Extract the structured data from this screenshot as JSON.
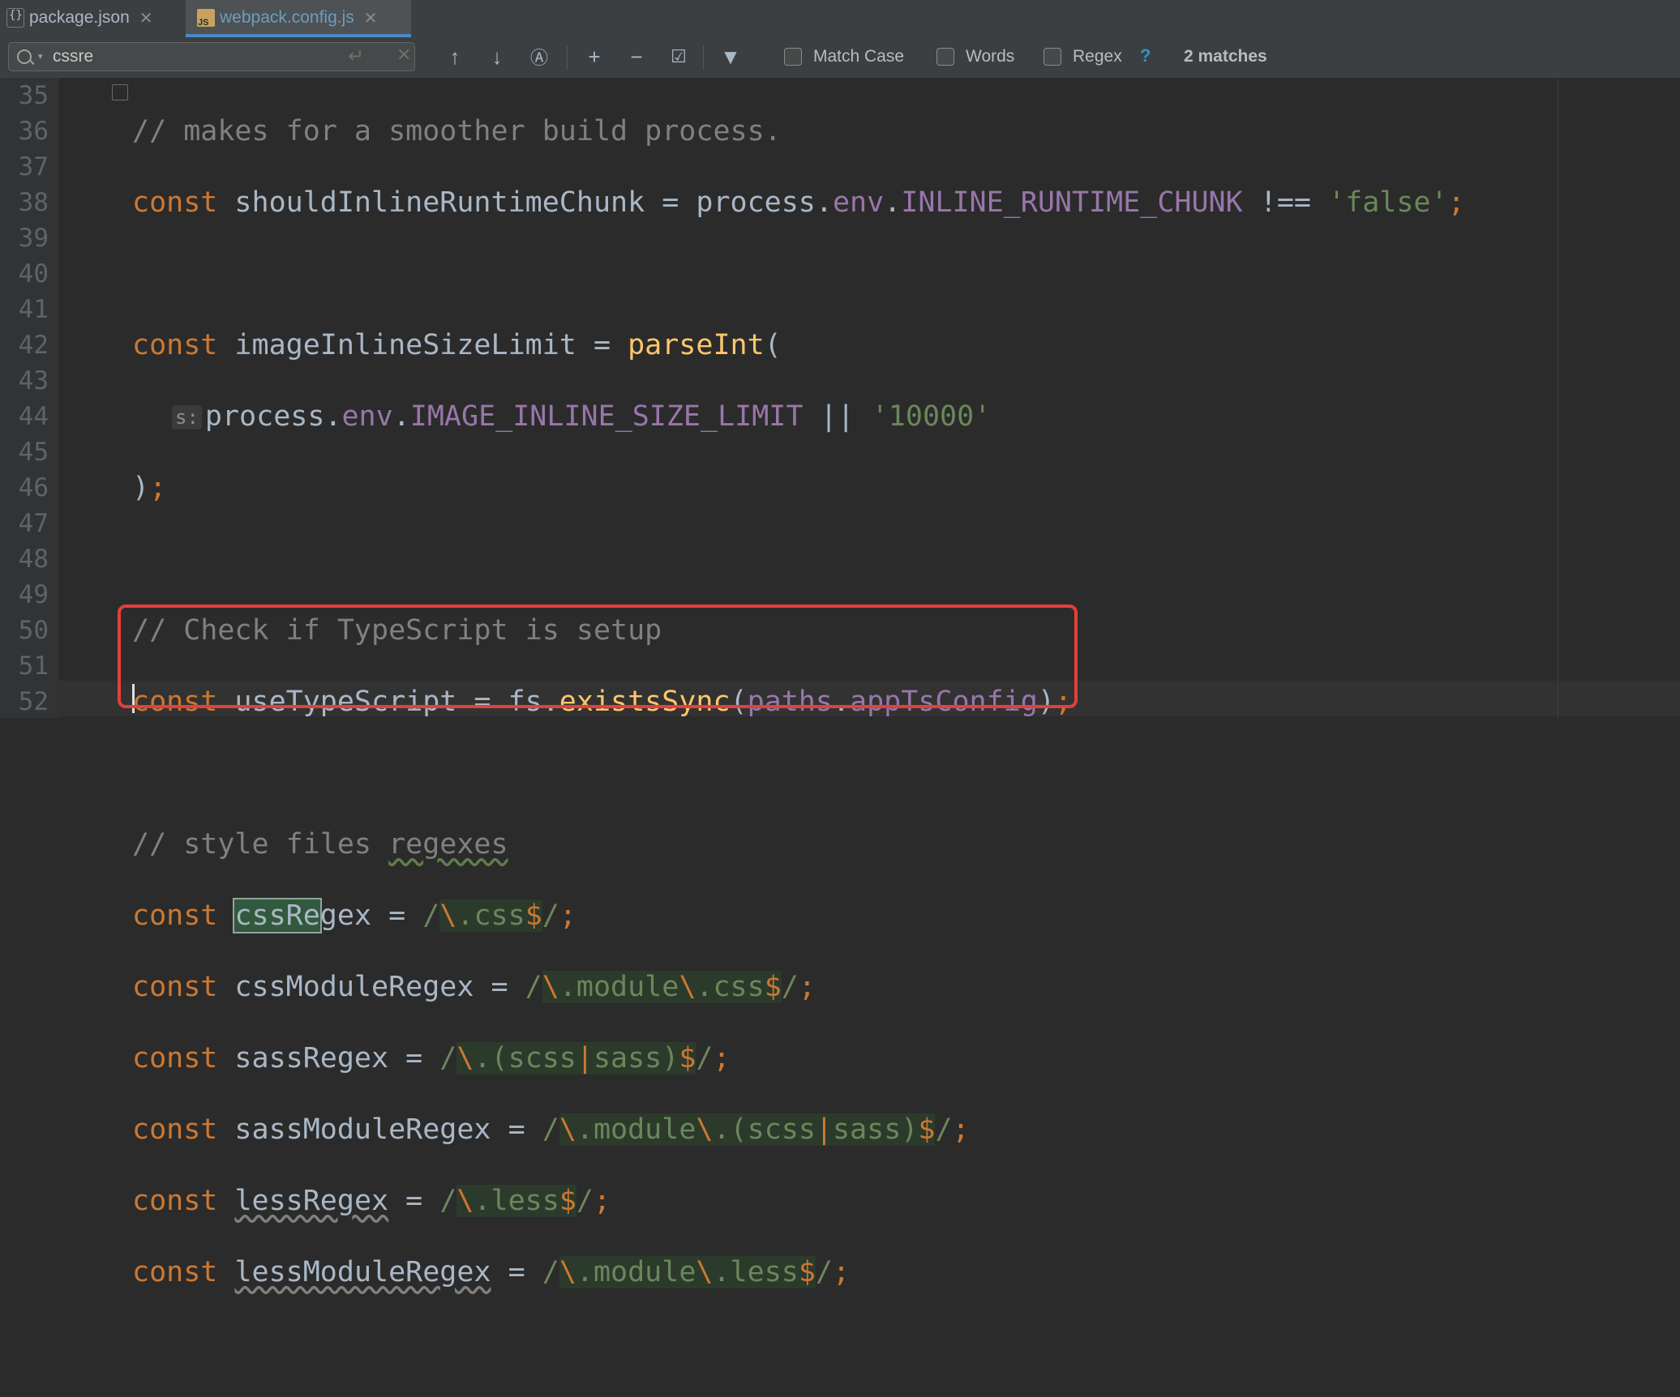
{
  "tabs": [
    {
      "label": "package.json",
      "icon": "json-file-icon"
    },
    {
      "label": "webpack.config.js",
      "icon": "js-file-icon",
      "active": true
    }
  ],
  "search": {
    "query": "cssre",
    "options": [
      {
        "label": "Match Case",
        "checked": false
      },
      {
        "label": "Words",
        "checked": false
      },
      {
        "label": "Regex",
        "checked": false
      }
    ],
    "help": "?",
    "result": "2 matches"
  },
  "editor": {
    "line_numbers": [
      "35",
      "36",
      "37",
      "38",
      "39",
      "40",
      "41",
      "42",
      "43",
      "44",
      "45",
      "46",
      "47",
      "48",
      "49",
      "50",
      "51",
      "52"
    ],
    "param_hint": "s:"
  },
  "colors": {
    "keyword": "#cc7832",
    "comment": "#808080",
    "string": "#6a8759",
    "property": "#9876aa",
    "function": "#ffc66d",
    "annotation_box": "#e2403a",
    "active_tab_underline": "#4a88c7"
  }
}
